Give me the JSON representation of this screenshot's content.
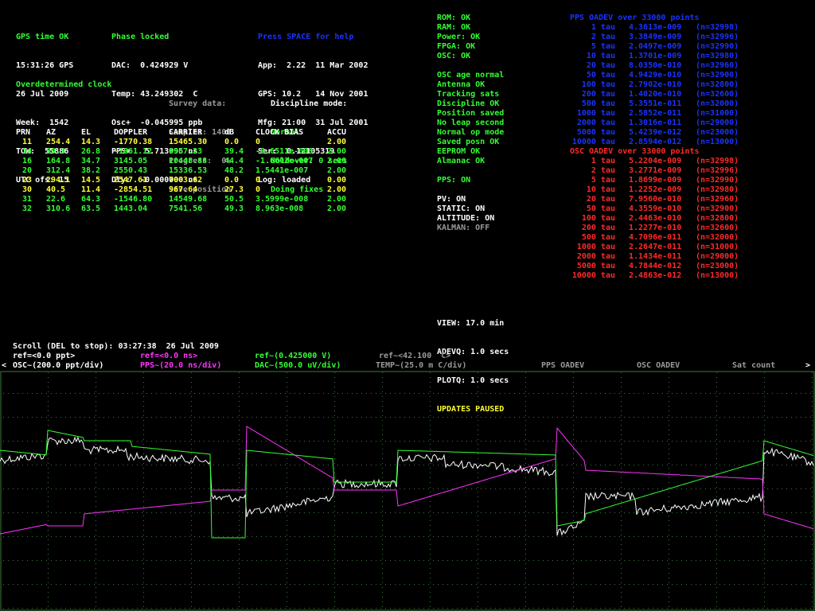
{
  "status": {
    "title": "GPS time OK",
    "lines": [
      "15:31:26 GPS",
      "26 Jul 2009",
      "Week:  1542",
      "TOW:  55886",
      "UTC ofs: 15"
    ]
  },
  "phase": {
    "title": "Phase locked",
    "lines": [
      "DAC:  0.424929 V",
      "Temp: 43.249302  C",
      "Osc+  -0.045995 ppb",
      "PPS+   5.713995 ns",
      "Dly:  -0.000000 ns"
    ]
  },
  "help": {
    "title": "Press SPACE for help",
    "lines": [
      "App:  2.22  11 Mar 2002",
      "GPS: 10.2   14 Nov 2001",
      "Mfg: 21:00  31 Jul 2001",
      "Ser:  0.12105319",
      "Log: loaded"
    ]
  },
  "mode": "Overdetermined clock",
  "survey": {
    "lines": [
      "Survey data:",
      "Samples: 1400",
      "Progress:  0%",
      "Save position"
    ]
  },
  "discipline": {
    "title": "Discipline mode:",
    "lines": [
      "Normal",
      "Holdover: 0 secs",
      "Doing fixes"
    ]
  },
  "sat_table": {
    "headers": [
      "PRN",
      "AZ",
      "EL",
      "DOPPLER",
      "CARRIER",
      "dB",
      "CLOCK BIAS",
      "ACCU"
    ],
    "rows": [
      {
        "c": "y",
        "cells": [
          "11",
          "254.4",
          "14.3",
          "-1770.38",
          "15465.30",
          "0.0",
          "0",
          "2.00"
        ]
      },
      {
        "c": "g",
        "cells": [
          "14",
          "80.3",
          "26.8",
          "-1861.12",
          "6967.23",
          "39.4",
          "-8.6511e-008",
          "2.00"
        ]
      },
      {
        "c": "g",
        "cells": [
          "16",
          "164.8",
          "34.7",
          "3145.05",
          "10448.88",
          "44.4",
          "-1.6602e-007",
          "2.00"
        ]
      },
      {
        "c": "g",
        "cells": [
          "20",
          "312.4",
          "38.2",
          "2550.43",
          "15336.53",
          "48.2",
          "1.5441e-007",
          "2.00"
        ]
      },
      {
        "c": "y",
        "cells": [
          "23",
          "294.1",
          "14.5",
          "2547.61",
          "7003.62",
          "0.0",
          "0",
          "0.00"
        ]
      },
      {
        "c": "y",
        "cells": [
          "30",
          "40.5",
          "11.4",
          "-2854.51",
          "967.64",
          "27.3",
          "0",
          "2.00"
        ]
      },
      {
        "c": "g",
        "cells": [
          "31",
          "22.6",
          "64.3",
          "-1546.80",
          "14549.68",
          "50.5",
          "3.5999e-008",
          "2.00"
        ]
      },
      {
        "c": "g",
        "cells": [
          "32",
          "310.6",
          "63.5",
          "1443.04",
          "7541.56",
          "49.3",
          "8.963e-008",
          "2.00"
        ]
      }
    ]
  },
  "health": [
    {
      "c": "g",
      "t": "ROM: OK"
    },
    {
      "c": "g",
      "t": "RAM: OK"
    },
    {
      "c": "g",
      "t": "Power: OK"
    },
    {
      "c": "g",
      "t": "FPGA: OK"
    },
    {
      "c": "g",
      "t": "OSC: OK"
    },
    {
      "c": "g",
      "t": ""
    },
    {
      "c": "g",
      "t": "OSC age normal"
    },
    {
      "c": "g",
      "t": "Antenna OK"
    },
    {
      "c": "g",
      "t": "Tracking sats"
    },
    {
      "c": "g",
      "t": "Discipline OK"
    },
    {
      "c": "g",
      "t": "Position saved"
    },
    {
      "c": "g",
      "t": "No leap second"
    },
    {
      "c": "g",
      "t": "Normal op mode"
    },
    {
      "c": "g",
      "t": "Saved posn OK"
    },
    {
      "c": "g",
      "t": "EEPROM OK"
    },
    {
      "c": "g",
      "t": "Almanac OK"
    },
    {
      "c": "g",
      "t": ""
    },
    {
      "c": "g",
      "t": "PPS: ON"
    },
    {
      "c": "g",
      "t": ""
    },
    {
      "c": "w",
      "t": "PV: ON"
    },
    {
      "c": "w",
      "t": "STATIC: ON"
    },
    {
      "c": "w",
      "t": "ALTITUDE: ON"
    },
    {
      "c": "gr",
      "t": "KALMAN: OFF"
    }
  ],
  "view": {
    "lines": [
      "VIEW: 17.0 min",
      "ADEVQ: 1.0 secs",
      "PLOTQ: 1.0 secs"
    ],
    "paused": "UPDATES PAUSED"
  },
  "pps_adev": {
    "title": "PPS OADEV over 33000 points",
    "rows": [
      [
        "1 tau",
        "4.3613e-009",
        "(n=32998)"
      ],
      [
        "2 tau",
        "3.3849e-009",
        "(n=32996)"
      ],
      [
        "5 tau",
        "2.0497e-009",
        "(n=32990)"
      ],
      [
        "10 tau",
        "1.3701e-009",
        "(n=32980)"
      ],
      [
        "20 tau",
        "8.0350e-010",
        "(n=32960)"
      ],
      [
        "50 tau",
        "4.9429e-010",
        "(n=32900)"
      ],
      [
        "100 tau",
        "2.7902e-010",
        "(n=32800)"
      ],
      [
        "200 tau",
        "1.4020e-010",
        "(n=32600)"
      ],
      [
        "500 tau",
        "5.3551e-011",
        "(n=32000)"
      ],
      [
        "1000 tau",
        "2.5852e-011",
        "(n=31000)"
      ],
      [
        "2000 tau",
        "1.3016e-011",
        "(n=29000)"
      ],
      [
        "5000 tau",
        "5.4239e-012",
        "(n=23000)"
      ],
      [
        "10000 tau",
        "2.8594e-012",
        "(n=13000)"
      ]
    ]
  },
  "osc_adev": {
    "title": "OSC OADEV over 33000 points",
    "rows": [
      [
        "1 tau",
        "5.2204e-009",
        "(n=32998)"
      ],
      [
        "2 tau",
        "3.2771e-009",
        "(n=32996)"
      ],
      [
        "5 tau",
        "1.8699e-009",
        "(n=32990)"
      ],
      [
        "10 tau",
        "1.2252e-009",
        "(n=32980)"
      ],
      [
        "20 tau",
        "7.9560e-010",
        "(n=32960)"
      ],
      [
        "50 tau",
        "4.3559e-010",
        "(n=32900)"
      ],
      [
        "100 tau",
        "2.4463e-010",
        "(n=32800)"
      ],
      [
        "200 tau",
        "1.2277e-010",
        "(n=32600)"
      ],
      [
        "500 tau",
        "4.7096e-011",
        "(n=32000)"
      ],
      [
        "1000 tau",
        "2.2647e-011",
        "(n=31000)"
      ],
      [
        "2000 tau",
        "1.1434e-011",
        "(n=29000)"
      ],
      [
        "5000 tau",
        "4.7844e-012",
        "(n=23000)"
      ],
      [
        "10000 tau",
        "2.4863e-012",
        "(n=13000)"
      ]
    ]
  },
  "plot_header": {
    "scroll": "Scroll (DEL to stop): 03:27:38  26 Jul 2009",
    "osc_ref": "ref=<0.0 ppt>",
    "osc_scale": "OSC~(200.0 ppt/div)",
    "pps_ref": "ref=<0.0 ns>",
    "pps_scale": "PPS~(20.0 ns/div)",
    "dac_ref": "ref~(0.425000 V)",
    "dac_scale": "DAC~(500.0 uV/div)",
    "temp_ref": "ref~<42.100  C>",
    "temp_scale": "TEMP~(25.0 m C/div)",
    "pps_adev": "PPS OADEV",
    "osc_adev": "OSC OADEV",
    "sat_count": "Sat count",
    "left_arrow": "<",
    "right_arrow": ">"
  },
  "colors": {
    "green": "#33ff33",
    "blue": "#1a33ff",
    "red": "#ff2a2a",
    "yellow": "#ffff33",
    "magenta": "#ff33ff",
    "gray": "#9a9a9a",
    "grid": "#3a7a3a"
  }
}
